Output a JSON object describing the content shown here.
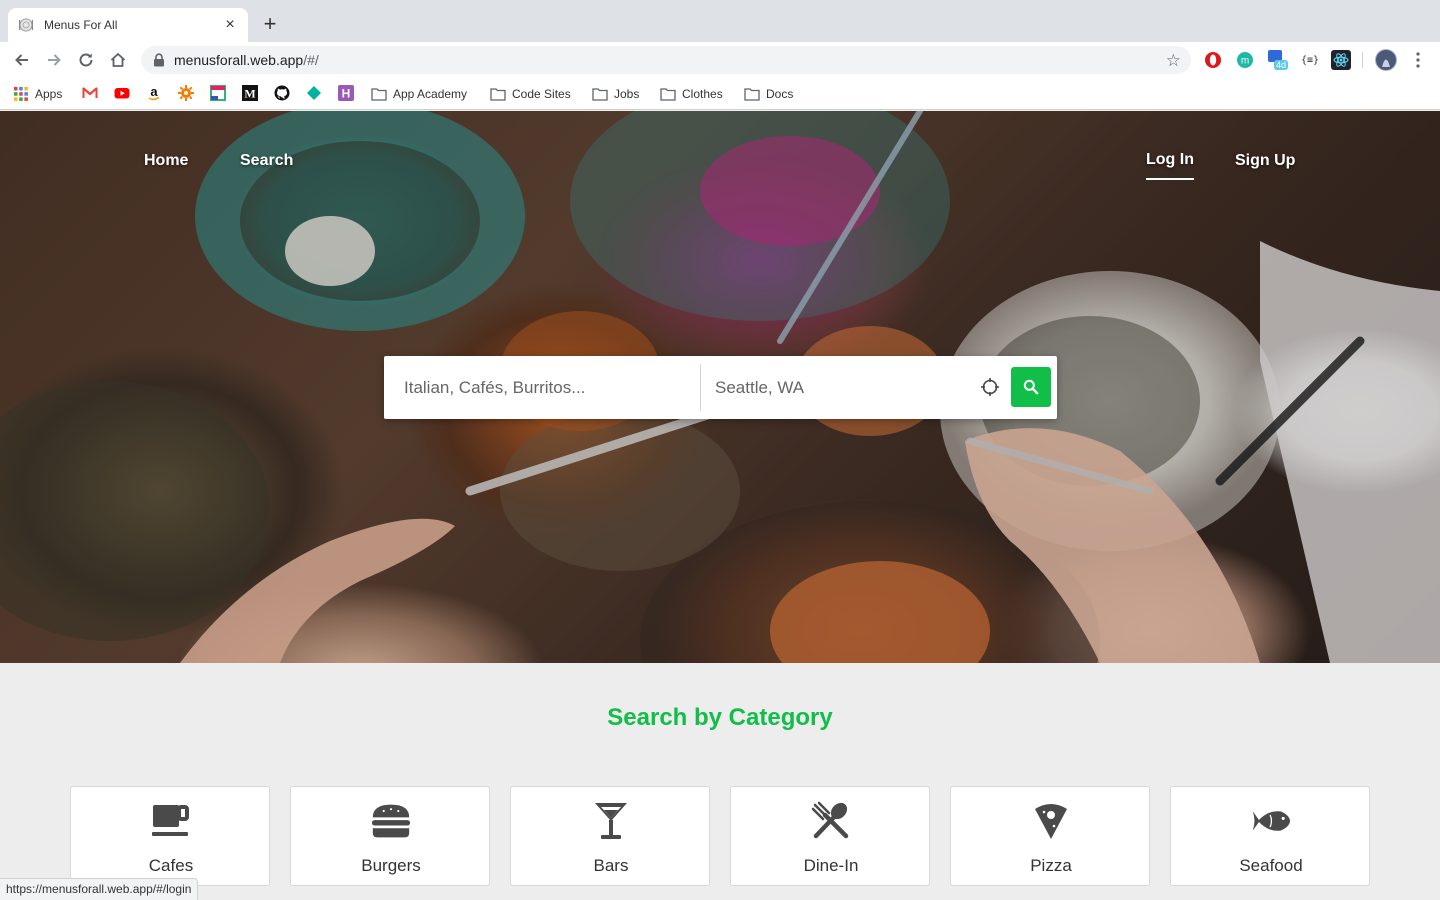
{
  "browser": {
    "tab_title": "Menus For All",
    "close_glyph": "×",
    "new_tab_glyph": "+",
    "url_host": "menusforall.web.app",
    "url_path": "/#/",
    "star_glyph": "☆",
    "extension_badge": "4d",
    "extension_braces": "{≡}"
  },
  "bookmarks": {
    "apps_label": "Apps",
    "folders": [
      "App Academy",
      "Code Sites",
      "Jobs",
      "Clothes",
      "Docs"
    ]
  },
  "hero": {
    "nav_left": [
      "Home",
      "Search"
    ],
    "login_label": "Log In",
    "signup_label": "Sign Up"
  },
  "search": {
    "query_placeholder": "Italian, Cafés, Burritos...",
    "location_placeholder": "Seattle, WA"
  },
  "categories": {
    "title": "Search by Category",
    "items": [
      {
        "label": "Cafes",
        "icon": "coffee-icon"
      },
      {
        "label": "Burgers",
        "icon": "burger-icon"
      },
      {
        "label": "Bars",
        "icon": "cocktail-icon"
      },
      {
        "label": "Dine-In",
        "icon": "utensils-icon"
      },
      {
        "label": "Pizza",
        "icon": "pizza-icon"
      },
      {
        "label": "Seafood",
        "icon": "fish-icon"
      }
    ]
  },
  "status_url": "https://menusforall.web.app/#/login",
  "colors": {
    "accent_green": "#11bf48",
    "page_background": "#ededed"
  }
}
